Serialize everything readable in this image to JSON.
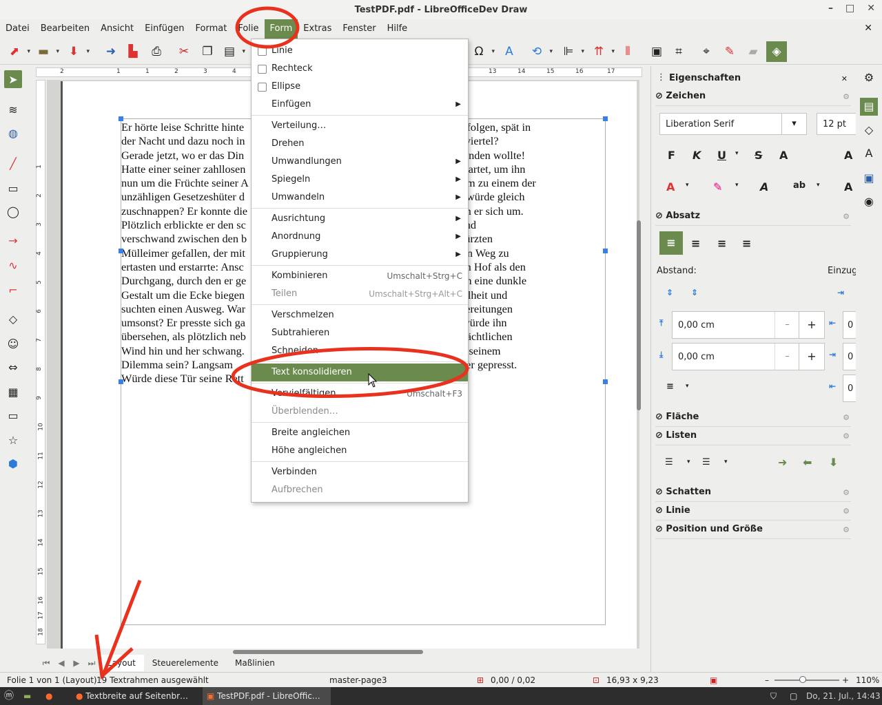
{
  "window": {
    "title": "TestPDF.pdf - LibreOfficeDev Draw",
    "minimize": "–",
    "maximize": "□",
    "close": "✕"
  },
  "menubar": {
    "items": [
      "Datei",
      "Bearbeiten",
      "Ansicht",
      "Einfügen",
      "Format",
      "Folie",
      "Form",
      "Extras",
      "Fenster",
      "Hilfe"
    ],
    "active": "Form",
    "close_doc": "✕"
  },
  "toolbar": {
    "icons": [
      "pdf-export-icon",
      "open-icon",
      "save-icon",
      "export-icon",
      "export-pdf-icon",
      "print-icon",
      "cut-icon",
      "copy-icon",
      "paste-icon",
      "special-character-icon",
      "fontwork-icon",
      "transformations-icon",
      "align-icon",
      "arrange-icon",
      "distribute-icon",
      "shadow-icon",
      "crop-icon",
      "points-icon",
      "glue-points-icon",
      "toggle-extrusion-icon",
      "image-icon"
    ]
  },
  "ruler": {
    "h_labels": [
      "2",
      "1",
      "1",
      "2",
      "3",
      "4",
      "13",
      "14",
      "15",
      "16",
      "17"
    ],
    "v_labels": [
      "1",
      "2",
      "3",
      "4",
      "5",
      "6",
      "7",
      "8",
      "9",
      "10",
      "11",
      "12",
      "13",
      "14",
      "15",
      "16",
      "17",
      "18"
    ]
  },
  "document": {
    "lines": [
      "Er hörte leise Schritte hinte                                                          le ihm schon folgen, spät in",
      "der Nacht und dazu noch in                                                         ndeten Hafenviertel?",
      "Gerade jetzt, wo er das Din                                                          eute verschwinden wollte!",
      "Hatte einer seiner zahllosen                                                         tet und abgewartet, um ihn",
      "nun um die Früchte seiner A                                                         ritte hinter ihm zu einem der",
      "unzähligen Gesetzeshüter d                                                         Handgelenke würde gleich",
      "zuschnappen? Er konnte die                                                         n. Gehetzt sah er sich um.",
      "Plötzlich erblickte er den sc                                                         nach rechts und",
      "verschwand zwischen den b                                                         r den umgestürzten",
      "Mülleimer gefallen, der mit                                                         nkelheit seinen Weg zu",
      "ertasten und erstarrte: Ansc                                                         diesem kleinen Hof als den",
      "Durchgang, durch den er ge                                                         d lauter, er sah eine dunkle",
      "Gestalt um die Ecke biegen                                                         htliche Dunkelheit und",
      "suchten einen Ausweg. War                                                         und alle Vorbereitungen",
      "umsonst? Er presste sich ga                                                         er Verfolger würde ihn",
      "übersehen, als plötzlich neb                                                         eine Tür im nächtlichen",
      "Wind hin und her schwang.                                                         e Ausweg aus seinem",
      "Dilemma sein? Langsam                                                         licht an die Mauer gepresst.",
      "Würde diese Tür seine Rett"
    ]
  },
  "form_menu": {
    "items": [
      {
        "label": "Linie",
        "type": "check",
        "disabled": false
      },
      {
        "label": "Rechteck",
        "type": "check",
        "disabled": false
      },
      {
        "label": "Ellipse",
        "type": "check",
        "disabled": false
      },
      {
        "label": "Einfügen",
        "type": "submenu",
        "disabled": false
      },
      {
        "label": "Verteilung…",
        "type": "item",
        "disabled": false
      },
      {
        "label": "Drehen",
        "type": "item",
        "disabled": false
      },
      {
        "label": "Umwandlungen",
        "type": "submenu",
        "disabled": false
      },
      {
        "label": "Spiegeln",
        "type": "submenu",
        "disabled": false
      },
      {
        "label": "Umwandeln",
        "type": "submenu",
        "disabled": false
      },
      {
        "label": "Ausrichtung",
        "type": "submenu",
        "disabled": false
      },
      {
        "label": "Anordnung",
        "type": "submenu",
        "disabled": false
      },
      {
        "label": "Gruppierung",
        "type": "submenu",
        "disabled": false
      },
      {
        "label": "Kombinieren",
        "type": "item",
        "shortcut": "Umschalt+Strg+C",
        "disabled": false
      },
      {
        "label": "Teilen",
        "type": "item",
        "shortcut": "Umschalt+Strg+Alt+C",
        "disabled": true
      },
      {
        "label": "Verschmelzen",
        "type": "item",
        "disabled": false
      },
      {
        "label": "Subtrahieren",
        "type": "item",
        "disabled": false
      },
      {
        "label": "Schneiden",
        "type": "item",
        "disabled": false
      },
      {
        "label": "Text konsolidieren",
        "type": "item",
        "disabled": false,
        "highlighted": true
      },
      {
        "label": "Vervielfältigen…",
        "type": "item",
        "shortcut": "Umschalt+F3",
        "disabled": false
      },
      {
        "label": "Überblenden…",
        "type": "item",
        "disabled": true
      },
      {
        "label": "Breite angleichen",
        "type": "item",
        "disabled": false
      },
      {
        "label": "Höhe angleichen",
        "type": "item",
        "disabled": false
      },
      {
        "label": "Verbinden",
        "type": "item",
        "disabled": false
      },
      {
        "label": "Aufbrechen",
        "type": "item",
        "disabled": true
      }
    ]
  },
  "sheet_tabs": {
    "tabs": [
      "Layout",
      "Steuerelemente",
      "Maßlinien"
    ],
    "active": "Layout"
  },
  "statusbar": {
    "slide": "Folie 1 von 1 (Layout)",
    "selection": "19 Textrahmen ausgewählt",
    "master": "master-page3",
    "position": "0,00 / 0,02",
    "size": "16,93 x 9,23",
    "zoom": "110%"
  },
  "taskbar": {
    "tasks": [
      "Textbreite auf Seitenbr…",
      "TestPDF.pdf - LibreOffic…"
    ],
    "clock": "Do, 21. Jul., 14:43"
  },
  "sidebar": {
    "title": "Eigenschaften",
    "panels": {
      "zeichen": "Zeichen",
      "absatz": "Absatz",
      "flaeche": "Fläche",
      "listen": "Listen",
      "schatten": "Schatten",
      "linie": "Linie",
      "position": "Position und Größe"
    },
    "font_name": "Liberation Serif",
    "font_size": "12 pt",
    "abstand_label": "Abstand:",
    "einzug_label": "Einzug",
    "spacing_above": "0,00 cm",
    "spacing_below": "0,00 cm",
    "minus": "–",
    "plus": "+",
    "clip_value": "0"
  },
  "colors": {
    "accent": "#6b8a4e",
    "annotation": "#e8321e"
  }
}
